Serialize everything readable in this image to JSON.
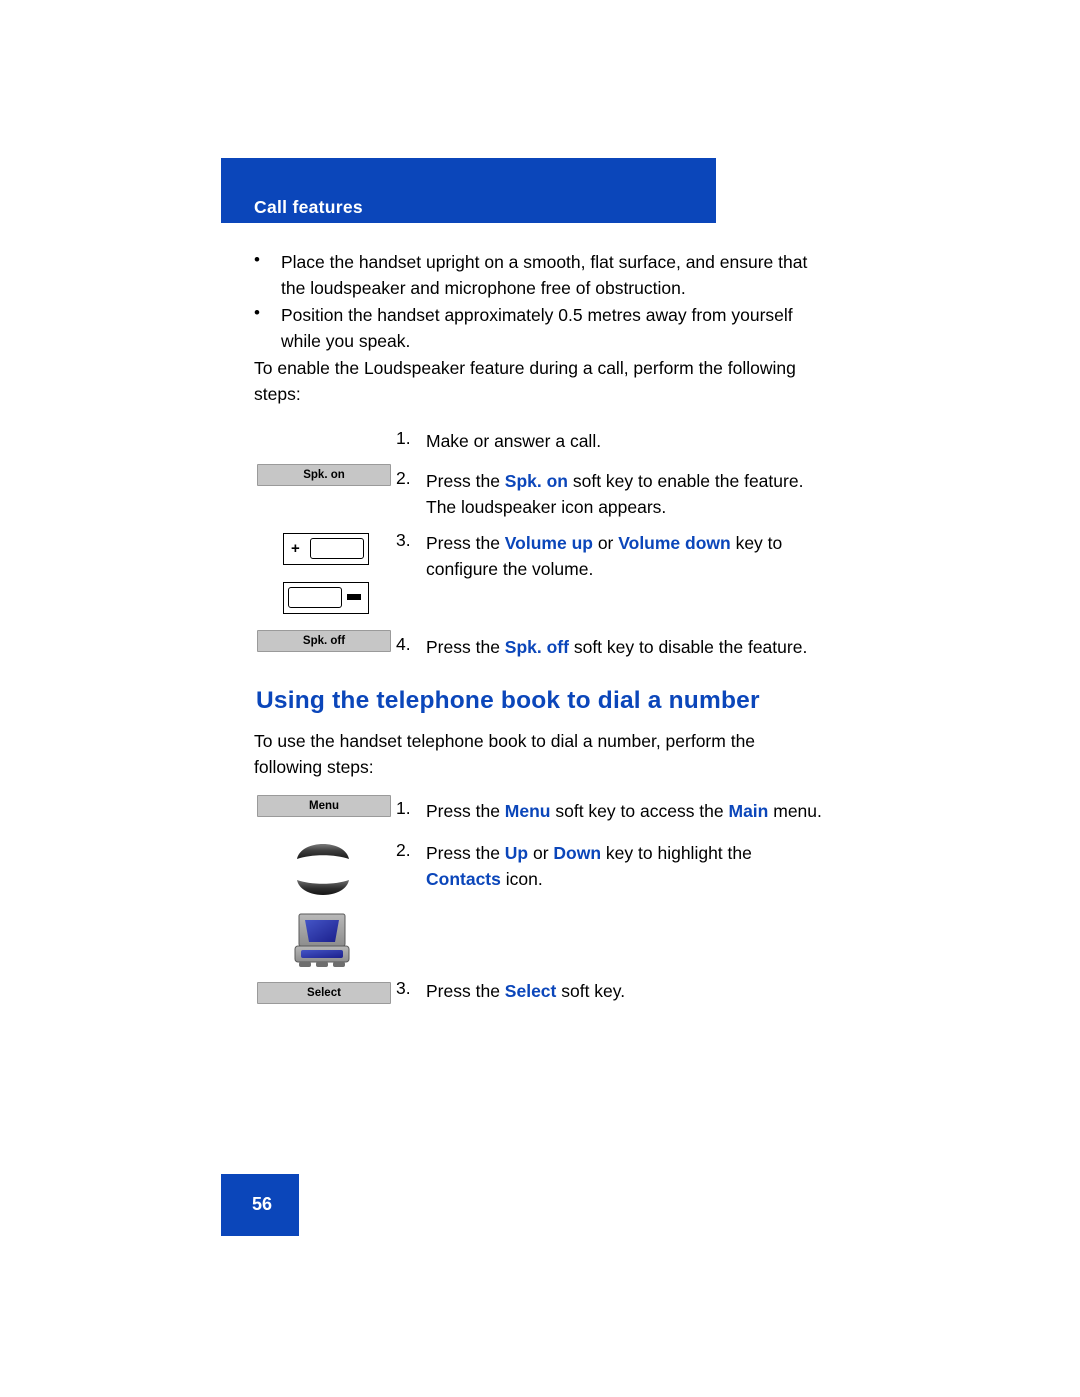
{
  "header": {
    "title": "Call features",
    "bar_color": "#0b46ba"
  },
  "bullets": [
    {
      "marker": "•",
      "line1": "Place the handset upright on a smooth, flat surface, and ensure that",
      "line2": "the loudspeaker and microphone free of obstruction."
    },
    {
      "marker": "•",
      "line1": "Position the handset approximately 0.5 metres away from yourself",
      "line2": "while you speak."
    }
  ],
  "intro": {
    "line1": "To enable the Loudspeaker feature during a call, perform the following",
    "line2": "steps:"
  },
  "steps1": [
    {
      "num": "1.",
      "text_a": "Make or answer a call.",
      "key_label": ""
    },
    {
      "num": "2.",
      "pre": "Press the ",
      "key": "Spk. on",
      "post": " soft key to enable the feature.",
      "line2": "The loudspeaker icon appears.",
      "key_label": "Spk. on"
    },
    {
      "num": "3.",
      "pre": "Press the ",
      "key": "Volume up",
      "mid": " or ",
      "key2": "Volume down",
      "post": " key to",
      "line2": "configure the volume."
    },
    {
      "num": "4.",
      "pre": "Press the ",
      "key": "Spk. off",
      "post": " soft key to disable the feature.",
      "key_label": "Spk. off"
    }
  ],
  "section": {
    "heading": "Using the telephone book to dial a number",
    "intro_line1": "To use the handset telephone book to dial a number, perform the",
    "intro_line2": "following steps:"
  },
  "steps2": [
    {
      "num": "1.",
      "pre": "Press the ",
      "key": "Menu",
      "mid": " soft key to access the ",
      "key2": "Main",
      "post": " menu.",
      "key_label": "Menu"
    },
    {
      "num": "2.",
      "pre": "Press the ",
      "key": "Up",
      "mid": " or ",
      "key2": "Down",
      "post": " key to highlight the",
      "line2_key": "Contacts",
      "line2_post": " icon."
    },
    {
      "num": "3.",
      "pre": "Press the ",
      "key": "Select",
      "post": " soft key.",
      "key_label": "Select"
    }
  ],
  "icons": {
    "up_nav": "nav-up-key-icon",
    "down_nav": "nav-down-key-icon",
    "contacts": "contacts-icon",
    "volume_up": "volume-up-key-icon",
    "volume_down": "volume-down-key-icon"
  },
  "footer": {
    "page_number": "56"
  },
  "colors": {
    "accent": "#0b46ba",
    "softkey_bg": "#c6c6c6"
  }
}
